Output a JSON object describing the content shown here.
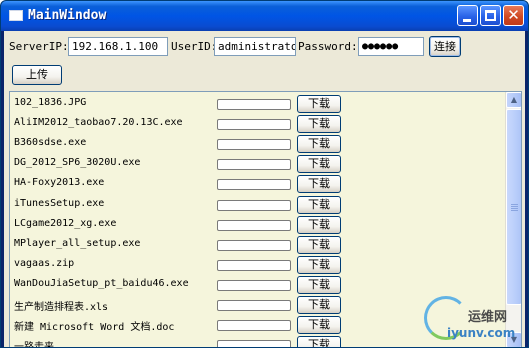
{
  "window": {
    "title": "MainWindow",
    "controls": {
      "minimize": "minimize-icon",
      "maximize": "maximize-icon",
      "close": "close-icon",
      "close_glyph": "✕"
    }
  },
  "connection": {
    "server_label": "ServerIP:",
    "server_value": "192.168.1.100",
    "user_label": "UserID:",
    "user_value": "administrato",
    "password_label": "Password:",
    "password_value": "●●●●●●",
    "connect_label": "连接"
  },
  "upload_label": "上传",
  "files": [
    {
      "name": "102_1836.JPG",
      "progress": 0,
      "button": "下载"
    },
    {
      "name": "AliIM2012_taobao7.20.13C.exe",
      "progress": 0,
      "button": "下载"
    },
    {
      "name": "B360sdse.exe",
      "progress": 0,
      "button": "下载"
    },
    {
      "name": "DG_2012_SP6_3020U.exe",
      "progress": 0,
      "button": "下载"
    },
    {
      "name": "HA-Foxy2013.exe",
      "progress": 0,
      "button": "下载"
    },
    {
      "name": "iTunesSetup.exe",
      "progress": 0,
      "button": "下载"
    },
    {
      "name": "LCgame2012_xg.exe",
      "progress": 0,
      "button": "下载"
    },
    {
      "name": "MPlayer_all_setup.exe",
      "progress": 0,
      "button": "下载"
    },
    {
      "name": "vagaas.zip",
      "progress": 0,
      "button": "下载"
    },
    {
      "name": "WanDouJiaSetup_pt_baidu46.exe",
      "progress": 0,
      "button": "下载"
    },
    {
      "name": "生产制造排程表.xls",
      "progress": 0,
      "button": "下载"
    },
    {
      "name": "新建 Microsoft Word 文档.doc",
      "progress": 0,
      "button": "下载"
    },
    {
      "name": "一路走来...",
      "progress": 0,
      "button": "下载"
    }
  ],
  "watermark": {
    "line1": "运维网",
    "line2": "iyunv.com"
  }
}
